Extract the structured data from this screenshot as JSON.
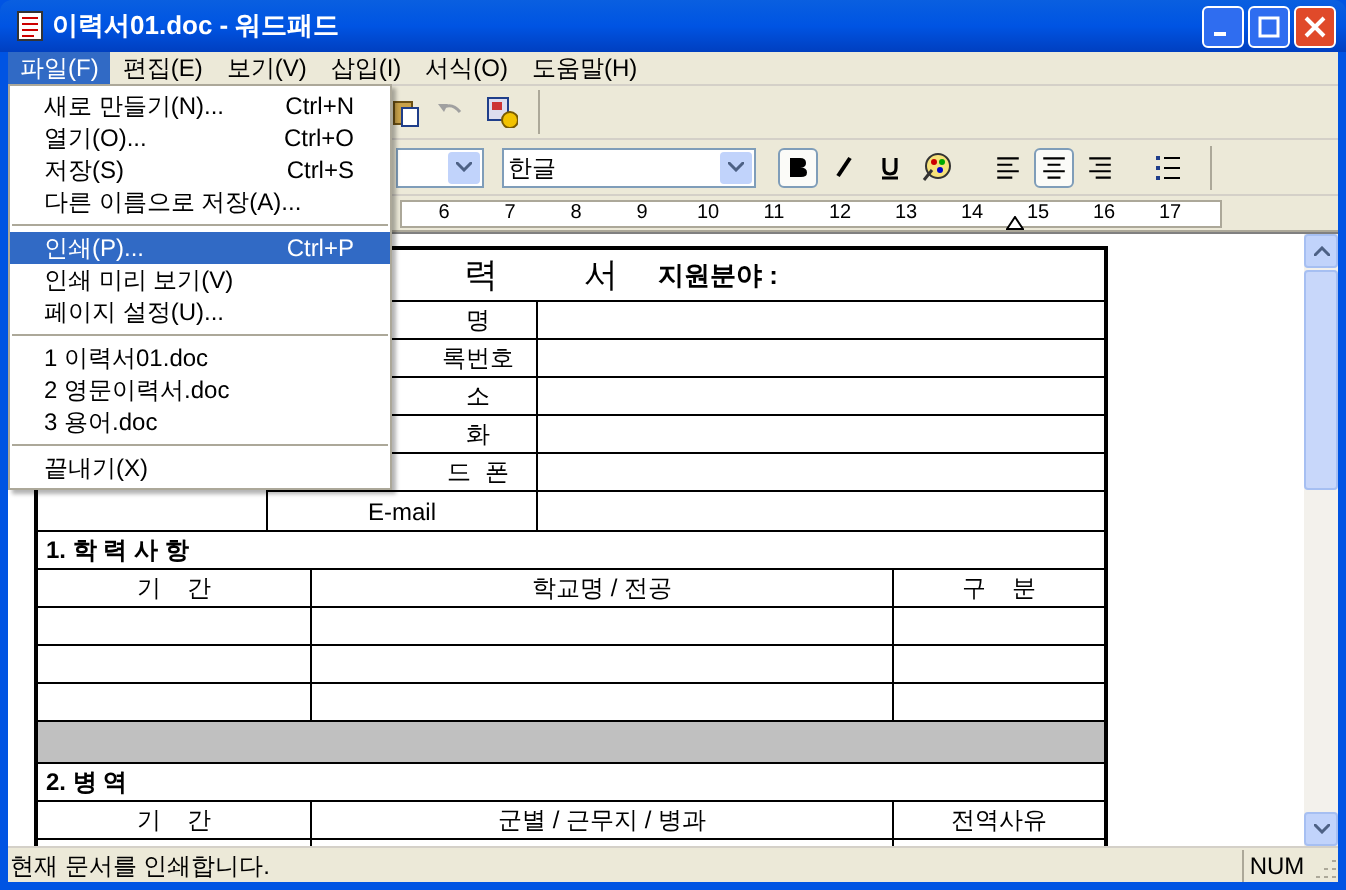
{
  "window": {
    "title": "이력서01.doc - 워드패드"
  },
  "menu_bar": [
    {
      "label": "파일(F)",
      "selected": true
    },
    {
      "label": "편집(E)",
      "selected": false
    },
    {
      "label": "보기(V)",
      "selected": false
    },
    {
      "label": "삽입(I)",
      "selected": false
    },
    {
      "label": "서식(O)",
      "selected": false
    },
    {
      "label": "도움말(H)",
      "selected": false
    }
  ],
  "file_menu": [
    {
      "kind": "item",
      "label": "새로 만들기(N)...",
      "shortcut": "Ctrl+N",
      "selected": false
    },
    {
      "kind": "item",
      "label": "열기(O)...",
      "shortcut": "Ctrl+O",
      "selected": false
    },
    {
      "kind": "item",
      "label": "저장(S)",
      "shortcut": "Ctrl+S",
      "selected": false
    },
    {
      "kind": "item",
      "label": "다른 이름으로 저장(A)...",
      "selected": false
    },
    {
      "kind": "separator"
    },
    {
      "kind": "item",
      "label": "인쇄(P)...",
      "shortcut": "Ctrl+P",
      "selected": true
    },
    {
      "kind": "item",
      "label": "인쇄 미리 보기(V)",
      "selected": false
    },
    {
      "kind": "item",
      "label": "페이지 설정(U)...",
      "selected": false
    },
    {
      "kind": "separator"
    },
    {
      "kind": "item",
      "label": "1 이력서01.doc",
      "selected": false
    },
    {
      "kind": "item",
      "label": "2 영문이력서.doc",
      "selected": false
    },
    {
      "kind": "item",
      "label": "3 용어.doc",
      "selected": false
    },
    {
      "kind": "separator"
    },
    {
      "kind": "item",
      "label": "끝내기(X)",
      "selected": false
    }
  ],
  "format_bar": {
    "script": "한글",
    "bold": true,
    "italic": false,
    "underline": false,
    "align": [
      {
        "selected": false
      },
      {
        "selected": true
      },
      {
        "selected": false
      }
    ]
  },
  "ruler": {
    "numbers": [
      "6",
      "7",
      "8",
      "9",
      "10",
      "11",
      "12",
      "13",
      "14",
      "15",
      "16",
      "17"
    ]
  },
  "document": {
    "title": [
      "력",
      "서"
    ],
    "field_label": "지원분야 :",
    "info_labels": [
      "명",
      "록번호",
      "소",
      "화",
      "드  폰",
      "E-mail"
    ],
    "sections": [
      {
        "heading": "1. 학 력 사 항",
        "columns": [
          "기    간",
          "학교명 / 전공",
          "구    분"
        ]
      },
      {
        "heading": "2. 병 역",
        "columns": [
          "기    간",
          "군별 / 근무지 / 병과",
          "전역사유"
        ]
      }
    ]
  },
  "status_bar": {
    "message": "현재 문서를 인쇄합니다.",
    "num": "NUM"
  }
}
